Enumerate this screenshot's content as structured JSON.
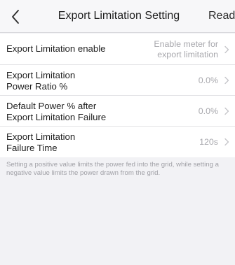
{
  "header": {
    "back_label": "<",
    "title": "Export Limitation Setting",
    "read_label": "Read"
  },
  "settings": [
    {
      "label": "Export Limitation enable",
      "value": "Enable meter for\nexport limitation"
    },
    {
      "label": "Export Limitation\nPower Ratio %",
      "value": "0.0%"
    },
    {
      "label": "Default Power % after\nExport Limitation Failure",
      "value": "0.0%"
    },
    {
      "label": "Export Limitation\nFailure Time",
      "value": "120s"
    }
  ],
  "hint": "Setting a positive value limits the power fed into the grid, while setting a negative value limits the power drawn from the grid.",
  "icons": {
    "back": "chevron-left-icon",
    "row_arrow": "chevron-right-icon"
  },
  "colors": {
    "header_bg": "#f7f7f9",
    "page_bg": "#f2f2f5",
    "label_text": "#1f1f1f",
    "value_text": "#a8a8ad",
    "hint_text": "#a0a0a6"
  }
}
